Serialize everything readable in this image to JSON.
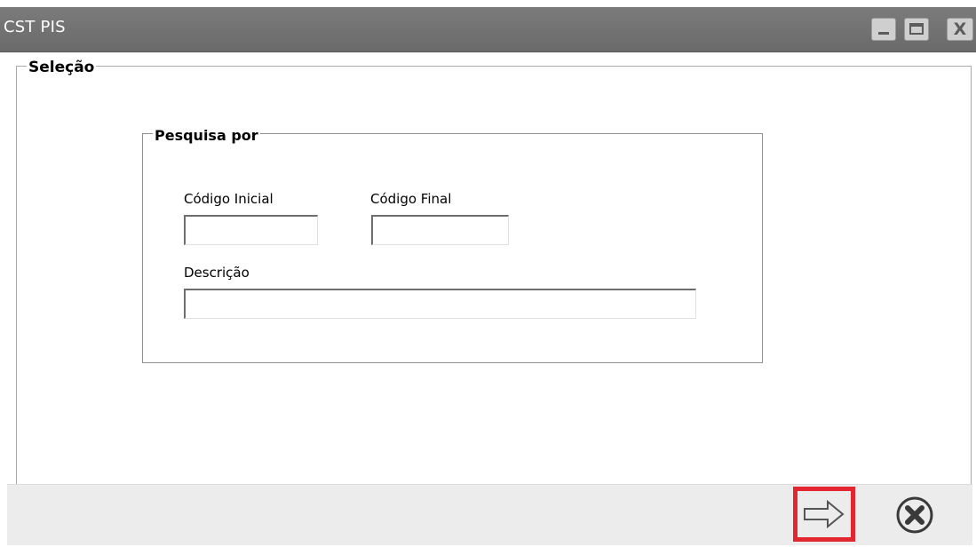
{
  "window": {
    "title": "CST PIS",
    "controls": {
      "minimize_icon": "minimize-icon",
      "maximize_icon": "maximize-icon",
      "close_icon": "close-icon",
      "close_glyph": "X"
    }
  },
  "selection_group": {
    "legend": "Seleção"
  },
  "search_group": {
    "legend": "Pesquisa por",
    "fields": {
      "codigo_inicial": {
        "label": "Código Inicial",
        "value": "",
        "placeholder": ""
      },
      "codigo_final": {
        "label": "Código Final",
        "value": "",
        "placeholder": ""
      },
      "descricao": {
        "label": "Descrição",
        "value": "",
        "placeholder": ""
      }
    }
  },
  "actions": {
    "next_icon": "arrow-right-icon",
    "cancel_icon": "cancel-circle-icon"
  },
  "colors": {
    "titlebar": "#6f6f6f",
    "highlight": "#e3262f",
    "bottom_bar": "#ececec"
  }
}
